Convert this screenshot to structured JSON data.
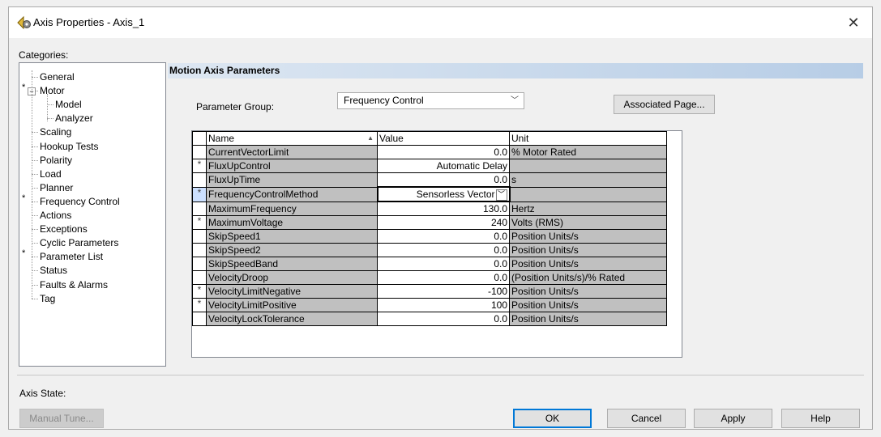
{
  "window": {
    "title": "Axis Properties - Axis_1",
    "close_label": "✕"
  },
  "categories": {
    "label": "Categories:",
    "items": [
      {
        "label": "General",
        "starred": false,
        "level": 0
      },
      {
        "label": "Motor",
        "starred": true,
        "level": 0,
        "expanded": true
      },
      {
        "label": "Model",
        "starred": false,
        "level": 1
      },
      {
        "label": "Analyzer",
        "starred": false,
        "level": 1
      },
      {
        "label": "Scaling",
        "starred": false,
        "level": 0
      },
      {
        "label": "Hookup Tests",
        "starred": false,
        "level": 0
      },
      {
        "label": "Polarity",
        "starred": false,
        "level": 0
      },
      {
        "label": "Load",
        "starred": false,
        "level": 0
      },
      {
        "label": "Planner",
        "starred": false,
        "level": 0
      },
      {
        "label": "Frequency Control",
        "starred": true,
        "level": 0
      },
      {
        "label": "Actions",
        "starred": false,
        "level": 0
      },
      {
        "label": "Exceptions",
        "starred": false,
        "level": 0
      },
      {
        "label": "Cyclic Parameters",
        "starred": false,
        "level": 0
      },
      {
        "label": "Parameter List",
        "starred": true,
        "level": 0
      },
      {
        "label": "Status",
        "starred": false,
        "level": 0
      },
      {
        "label": "Faults & Alarms",
        "starred": false,
        "level": 0
      },
      {
        "label": "Tag",
        "starred": false,
        "level": 0
      }
    ]
  },
  "section": {
    "title": "Motion Axis Parameters"
  },
  "parameter_group": {
    "label": "Parameter Group:",
    "value": "Frequency Control",
    "arrow": "﹀"
  },
  "associated_page_button": "Associated Page...",
  "grid": {
    "headers": {
      "name": "Name",
      "value": "Value",
      "unit": "Unit"
    },
    "rows": [
      {
        "marker": "",
        "name": "CurrentVectorLimit",
        "value": "0.0",
        "unit": "% Motor Rated"
      },
      {
        "marker": "*",
        "name": "FluxUpControl",
        "value": "Automatic Delay",
        "unit": ""
      },
      {
        "marker": "",
        "name": "FluxUpTime",
        "value": "0.0",
        "unit": "s"
      },
      {
        "marker": "*",
        "name": "FrequencyControlMethod",
        "value": "Sensorless Vector",
        "unit": "",
        "selected": true
      },
      {
        "marker": "",
        "name": "MaximumFrequency",
        "value": "130.0",
        "unit": "Hertz"
      },
      {
        "marker": "*",
        "name": "MaximumVoltage",
        "value": "240",
        "unit": "Volts (RMS)"
      },
      {
        "marker": "",
        "name": "SkipSpeed1",
        "value": "0.0",
        "unit": "Position Units/s"
      },
      {
        "marker": "",
        "name": "SkipSpeed2",
        "value": "0.0",
        "unit": "Position Units/s"
      },
      {
        "marker": "",
        "name": "SkipSpeedBand",
        "value": "0.0",
        "unit": "Position Units/s"
      },
      {
        "marker": "",
        "name": "VelocityDroop",
        "value": "0.0",
        "unit": "(Position Units/s)/% Rated"
      },
      {
        "marker": "*",
        "name": "VelocityLimitNegative",
        "value": "-100",
        "unit": "Position Units/s"
      },
      {
        "marker": "*",
        "name": "VelocityLimitPositive",
        "value": "100",
        "unit": "Position Units/s"
      },
      {
        "marker": "",
        "name": "VelocityLockTolerance",
        "value": "0.0",
        "unit": "Position Units/s"
      }
    ]
  },
  "axis_state": {
    "label": "Axis State:"
  },
  "buttons": {
    "manual_tune": "Manual Tune...",
    "ok": "OK",
    "cancel": "Cancel",
    "apply": "Apply",
    "help": "Help"
  }
}
